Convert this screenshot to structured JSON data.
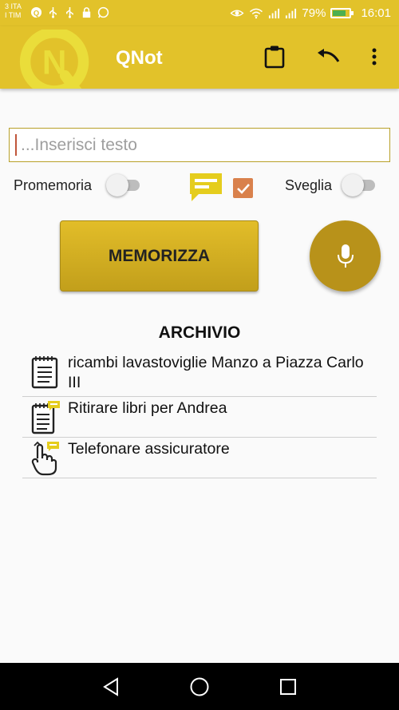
{
  "status_bar": {
    "carrier_line1": "3 ITA",
    "carrier_line2": "I TIM",
    "battery_text": "79%",
    "battery_level": 0.79,
    "time": "16:01"
  },
  "app_bar": {
    "title": "QNot",
    "logo_icon": "qnot-logo-icon",
    "actions": [
      "clipboard-icon",
      "undo-icon",
      "more-vert-icon"
    ]
  },
  "input": {
    "placeholder": "...Inserisci testo",
    "value": ""
  },
  "options": {
    "reminder_label": "Promemoria",
    "reminder_on": false,
    "alarm_label": "Sveglia",
    "alarm_on": false,
    "message_checkbox_checked": true
  },
  "buttons": {
    "memorize_label": "MEMORIZZA",
    "mic_icon": "microphone-icon"
  },
  "archive": {
    "title": "ARCHIVIO",
    "items": [
      {
        "text": "ricambi lavastoviglie Manzo a Piazza Carlo III",
        "icon": "notepad-icon"
      },
      {
        "text": "Ritirare libri per Andrea",
        "icon": "notepad-message-icon"
      },
      {
        "text": "Telefonare assicuratore",
        "icon": "touch-message-icon"
      }
    ]
  },
  "colors": {
    "accent": "#e2c22a",
    "button": "#c9a61f",
    "mic": "#b8921a",
    "checkbox": "#d9814c"
  },
  "nav_bar": [
    "back-icon",
    "home-icon",
    "recents-icon"
  ]
}
